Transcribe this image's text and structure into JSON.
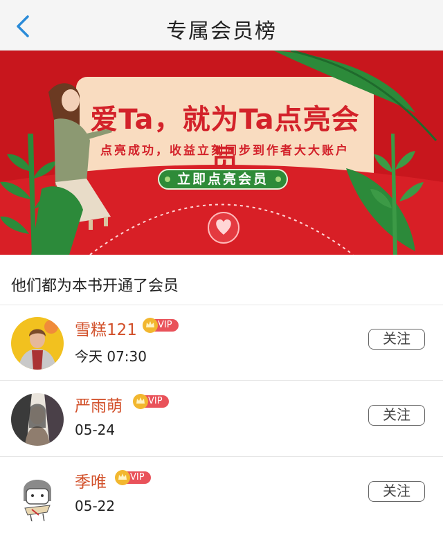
{
  "header": {
    "title": "专属会员榜",
    "back_icon": "chevron-left-icon"
  },
  "banner": {
    "title": "爱Ta，就为Ta点亮会员",
    "subtitle": "点亮成功，收益立刻同步到作者大大账户",
    "button_label": "立即点亮会员",
    "colors": {
      "background": "#c8161d",
      "card": "#f9dcc0",
      "button": "#2e8b38"
    }
  },
  "section": {
    "title": "他们都为本书开通了会员"
  },
  "members": [
    {
      "name": "雪糕121",
      "vip_label": "VIP",
      "date": "今天 07:30",
      "follow_label": "关注"
    },
    {
      "name": "严雨萌",
      "vip_label": "VIP",
      "date": "05-24",
      "follow_label": "关注"
    },
    {
      "name": "季唯",
      "vip_label": "VIP",
      "date": "05-22",
      "follow_label": "关注"
    }
  ],
  "colors": {
    "name": "#d2502a",
    "vip_badge": "#e9525a",
    "crown": "#f2b72f"
  }
}
